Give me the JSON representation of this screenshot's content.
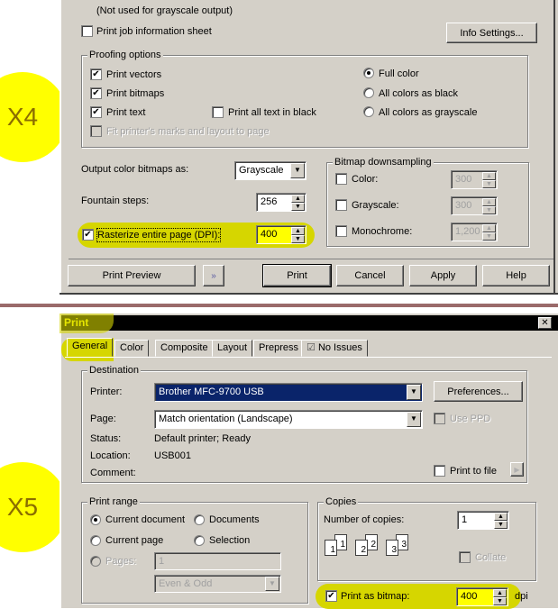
{
  "badges": {
    "top": "X4",
    "bottom": "X5"
  },
  "top_dialog": {
    "note": "(Not used for grayscale output)",
    "print_job_info": {
      "label": "Print job information sheet",
      "checked": false
    },
    "info_settings_button": "Info Settings...",
    "proofing": {
      "title": "Proofing options",
      "print_vectors": {
        "label": "Print vectors",
        "checked": true
      },
      "print_bitmaps": {
        "label": "Print bitmaps",
        "checked": true
      },
      "print_text": {
        "label": "Print text",
        "checked": true
      },
      "print_all_black": {
        "label": "Print all text in black",
        "checked": false
      },
      "fit_marks": {
        "label": "Fit printer's marks and layout to page",
        "checked": false,
        "disabled": true
      },
      "color_radios": [
        {
          "label": "Full color",
          "selected": true
        },
        {
          "label": "All colors as black",
          "selected": false
        },
        {
          "label": "All colors as grayscale",
          "selected": false
        }
      ]
    },
    "output_bitmaps": {
      "label": "Output color bitmaps as:",
      "value": "Grayscale"
    },
    "fountain_steps": {
      "label": "Fountain steps:",
      "value": "256"
    },
    "rasterize": {
      "label": "Rasterize entire page (DPI):",
      "checked": true,
      "value": "400"
    },
    "downsampling": {
      "title": "Bitmap downsampling",
      "color": {
        "label": "Color:",
        "checked": false,
        "value": "300"
      },
      "grayscale": {
        "label": "Grayscale:",
        "checked": false,
        "value": "300"
      },
      "monochrome": {
        "label": "Monochrome:",
        "checked": false,
        "value": "1,200"
      }
    },
    "buttons": {
      "print_preview": "Print Preview",
      "print": "Print",
      "cancel": "Cancel",
      "apply": "Apply",
      "help": "Help"
    }
  },
  "bottom_dialog": {
    "title": "Print",
    "close_glyph": "✕",
    "tabs": [
      "General",
      "Color",
      "Composite",
      "Layout",
      "Prepress",
      "No Issues"
    ],
    "destination": {
      "title": "Destination",
      "printer_label": "Printer:",
      "printer_value": "Brother MFC-9700 USB",
      "preferences_button": "Preferences...",
      "page_label": "Page:",
      "page_value": "Match orientation (Landscape)",
      "use_ppd": {
        "label": "Use PPD",
        "checked": false,
        "disabled": true
      },
      "status_label": "Status:",
      "status_value": "Default printer; Ready",
      "location_label": "Location:",
      "location_value": "USB001",
      "comment_label": "Comment:",
      "print_to_file": {
        "label": "Print to file",
        "checked": false
      }
    },
    "print_range": {
      "title": "Print range",
      "current_document": {
        "label": "Current document",
        "selected": true
      },
      "documents": {
        "label": "Documents",
        "selected": false
      },
      "current_page": {
        "label": "Current page",
        "selected": false
      },
      "selection": {
        "label": "Selection",
        "selected": false
      },
      "pages": {
        "label": "Pages:",
        "selected": false,
        "value": "1"
      },
      "even_odd": "Even & Odd"
    },
    "copies": {
      "title": "Copies",
      "number_label": "Number of copies:",
      "number_value": "1",
      "collate": {
        "label": "Collate",
        "checked": false,
        "disabled": true
      },
      "page_icons": [
        "1",
        "1",
        "2",
        "2",
        "3",
        "3"
      ]
    },
    "print_as_bitmap": {
      "label": "Print as bitmap:",
      "checked": true,
      "value": "400",
      "unit": "dpi"
    }
  }
}
